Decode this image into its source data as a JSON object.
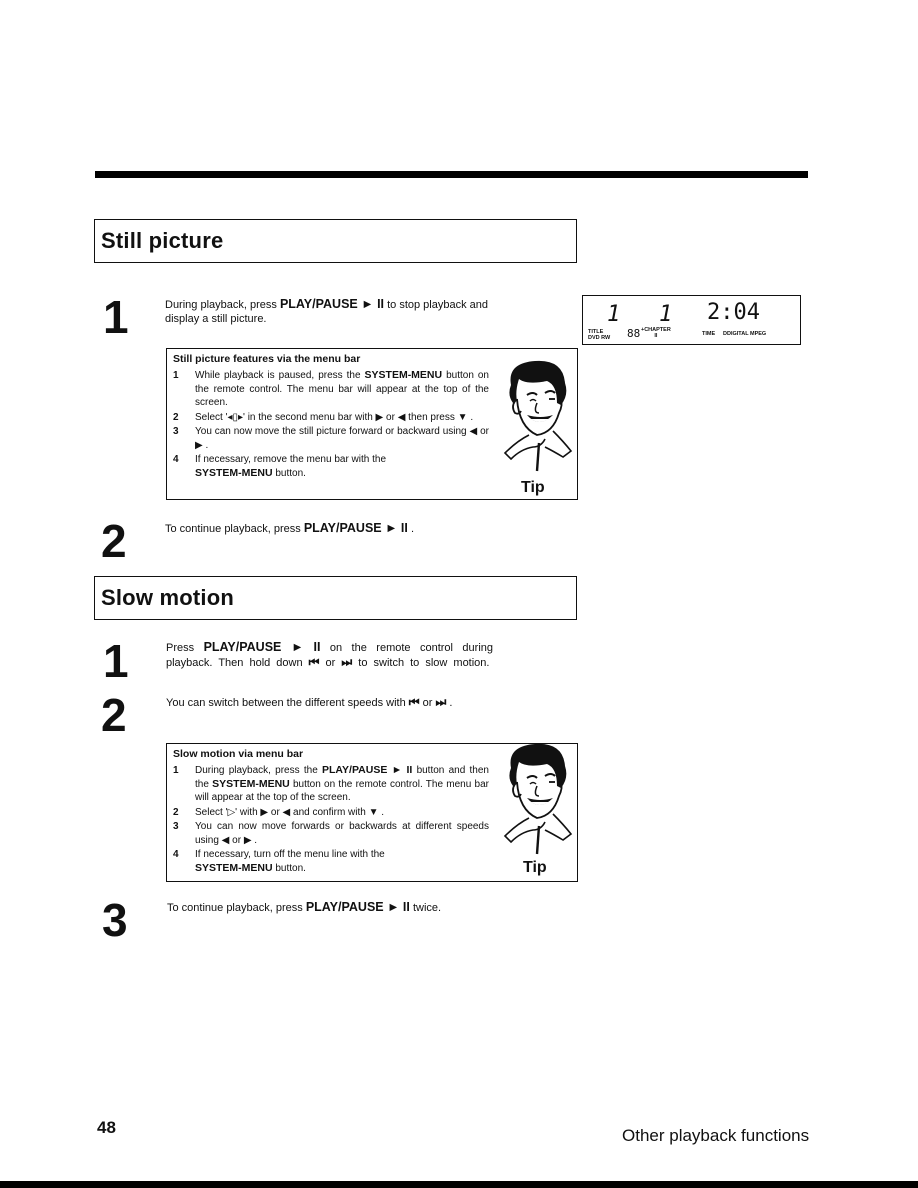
{
  "page": {
    "number": "48",
    "section_footer": "Other playback functions"
  },
  "still_picture": {
    "title": "Still picture",
    "step1": {
      "num": "1",
      "pre": "During playback, press",
      "key": "PLAY/PAUSE ► II",
      "post": "to stop playback and display a still picture."
    },
    "tip": {
      "title": "Still picture features via the menu bar",
      "items": [
        {
          "n": "1",
          "pre": "While playback is paused, press the",
          "key": "SYSTEM-MENU",
          "post": "button on the remote control. The menu bar will appear at the top of the screen."
        },
        {
          "n": "2",
          "pre": "Select '◂▯▸' in the second menu bar with ▶ or ◀ then press ▼ .",
          "key": "",
          "post": ""
        },
        {
          "n": "3",
          "pre": "You can now move the still picture forward or backward using ◀ or ▶ .",
          "key": "",
          "post": ""
        },
        {
          "n": "4",
          "pre": "If necessary, remove the menu bar with the",
          "key": "SYSTEM-MENU",
          "post": "button."
        }
      ],
      "label": "Tip"
    },
    "step2": {
      "num": "2",
      "pre": "To continue playback, press",
      "key": "PLAY/PAUSE ► II",
      "post": "."
    }
  },
  "display_panel": {
    "title_value": "1",
    "chapter_value": "1",
    "time_value": "2:04",
    "label_title": "TITLE",
    "label_dvd": "DVD RW",
    "label_segments": "88",
    "label_chapter": "+CHAPTER",
    "label_chapter_sub": "II",
    "label_time": "TIME",
    "label_digital": "DDIGITAL MPEG"
  },
  "slow_motion": {
    "title": "Slow motion",
    "step1": {
      "num": "1",
      "pre": "Press",
      "key": "PLAY/PAUSE ► II",
      "mid": "on the remote control during playback. Then hold down",
      "key2": "⏮",
      "or": "or",
      "key3": "⏭",
      "post": "to switch to slow motion."
    },
    "step2": {
      "num": "2",
      "pre": "You can switch between the different speeds with",
      "key": "⏮",
      "or": "or",
      "key2": "⏭",
      "post": "."
    },
    "tip": {
      "title": "Slow motion via menu bar",
      "items": [
        {
          "n": "1",
          "pre": "During playback, press the",
          "key": "PLAY/PAUSE ► II",
          "mid": "button and then the",
          "key2": "SYSTEM-MENU",
          "post": "button on the remote control. The menu bar will appear at the top of the screen."
        },
        {
          "n": "2",
          "pre": "Select '▷' with ▶ or ◀ and confirm with ▼ .",
          "key": "",
          "mid": "",
          "key2": "",
          "post": ""
        },
        {
          "n": "3",
          "pre": "You can now move forwards or backwards at different speeds using ◀ or ▶ .",
          "key": "",
          "mid": "",
          "key2": "",
          "post": ""
        },
        {
          "n": "4",
          "pre": "If necessary, turn off the menu line with the",
          "key": "",
          "mid": "",
          "key2": "SYSTEM-MENU",
          "post": "button."
        }
      ],
      "label": "Tip"
    },
    "step3": {
      "num": "3",
      "pre": "To continue playback, press",
      "key": "PLAY/PAUSE ► II",
      "post": "twice."
    }
  }
}
